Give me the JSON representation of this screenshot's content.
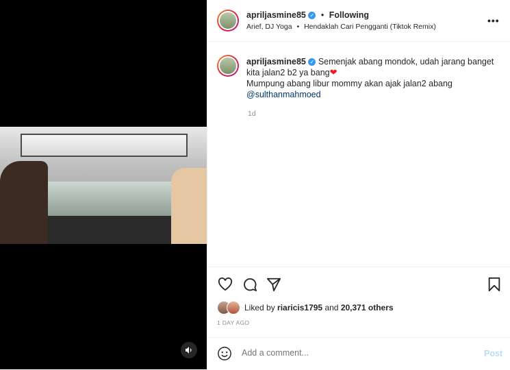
{
  "header": {
    "username": "apriljasmine85",
    "separator": "•",
    "following_label": "Following",
    "audio": "Arief, DJ Yoga",
    "audio_track": "Hendaklah Cari Pengganti (Tiktok Remix)",
    "more_icon": "more-options-icon"
  },
  "caption": {
    "username": "apriljasmine85",
    "text": "Semenjak abang mondok, udah jarang banget kita jalan2 b2 ya bang",
    "emoji": "❤",
    "line2": "Mumpung abang libur mommy akan ajak jalan2 abang",
    "mention": "@sulthanmahmoed",
    "time": "1d"
  },
  "actions": {
    "like_icon": "heart-icon",
    "comment_icon": "comment-icon",
    "share_icon": "share-icon",
    "save_icon": "bookmark-icon"
  },
  "likes": {
    "prefix": "Liked by",
    "user": "riaricis1795",
    "and": "and",
    "count": "20,371 others"
  },
  "posted_ago": "1 DAY AGO",
  "comment_box": {
    "placeholder": "Add a comment...",
    "post_label": "Post"
  },
  "colors": {
    "verified": "#3897f0",
    "post_disabled": "#b2dffc",
    "mention": "#00376b"
  }
}
